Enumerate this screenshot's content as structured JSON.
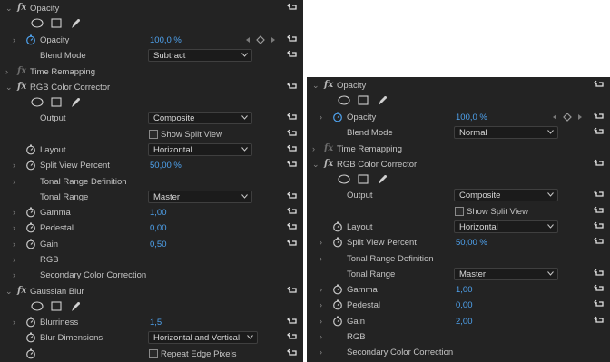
{
  "left": {
    "opacity_section": {
      "title": "Opacity",
      "param_label": "Opacity",
      "param_value": "100,0 %",
      "blend_label": "Blend Mode",
      "blend_value": "Subtract"
    },
    "time_remapping": "Time Remapping",
    "rgb": {
      "title": "RGB Color Corrector",
      "output_label": "Output",
      "output_value": "Composite",
      "split_view_label": "Show Split View",
      "layout_label": "Layout",
      "layout_value": "Horizontal",
      "split_percent_label": "Split View Percent",
      "split_percent_value": "50,00 %",
      "tonal_def_label": "Tonal Range Definition",
      "tonal_range_label": "Tonal Range",
      "tonal_range_value": "Master",
      "gamma_label": "Gamma",
      "gamma_value": "1,00",
      "pedestal_label": "Pedestal",
      "pedestal_value": "0,00",
      "gain_label": "Gain",
      "gain_value": "0,50",
      "rgb_label": "RGB",
      "secondary_label": "Secondary Color Correction"
    },
    "blur": {
      "title": "Gaussian Blur",
      "blurriness_label": "Blurriness",
      "blurriness_value": "1,5",
      "dimensions_label": "Blur Dimensions",
      "dimensions_value": "Horizontal and Vertical",
      "repeat_label": "Repeat Edge Pixels"
    }
  },
  "right": {
    "opacity_section": {
      "title": "Opacity",
      "param_label": "Opacity",
      "param_value": "100,0 %",
      "blend_label": "Blend Mode",
      "blend_value": "Normal"
    },
    "time_remapping": "Time Remapping",
    "rgb": {
      "title": "RGB Color Corrector",
      "output_label": "Output",
      "output_value": "Composite",
      "split_view_label": "Show Split View",
      "layout_label": "Layout",
      "layout_value": "Horizontal",
      "split_percent_label": "Split View Percent",
      "split_percent_value": "50,00 %",
      "tonal_def_label": "Tonal Range Definition",
      "tonal_range_label": "Tonal Range",
      "tonal_range_value": "Master",
      "gamma_label": "Gamma",
      "gamma_value": "1,00",
      "pedestal_label": "Pedestal",
      "pedestal_value": "0,00",
      "gain_label": "Gain",
      "gain_value": "2,00",
      "rgb_label": "RGB",
      "secondary_label": "Secondary Color Correction"
    }
  },
  "icons": {
    "reset": "reset-icon",
    "stopwatch": "stopwatch-icon",
    "ellipse_mask": "ellipse-mask-icon",
    "rect_mask": "rectangle-mask-icon",
    "pen_mask": "pen-mask-icon",
    "fx_badge": "fx-badge"
  },
  "colors": {
    "panel_bg": "#232323",
    "value_blue": "#4fa3ef",
    "text": "#c4c4c4"
  }
}
